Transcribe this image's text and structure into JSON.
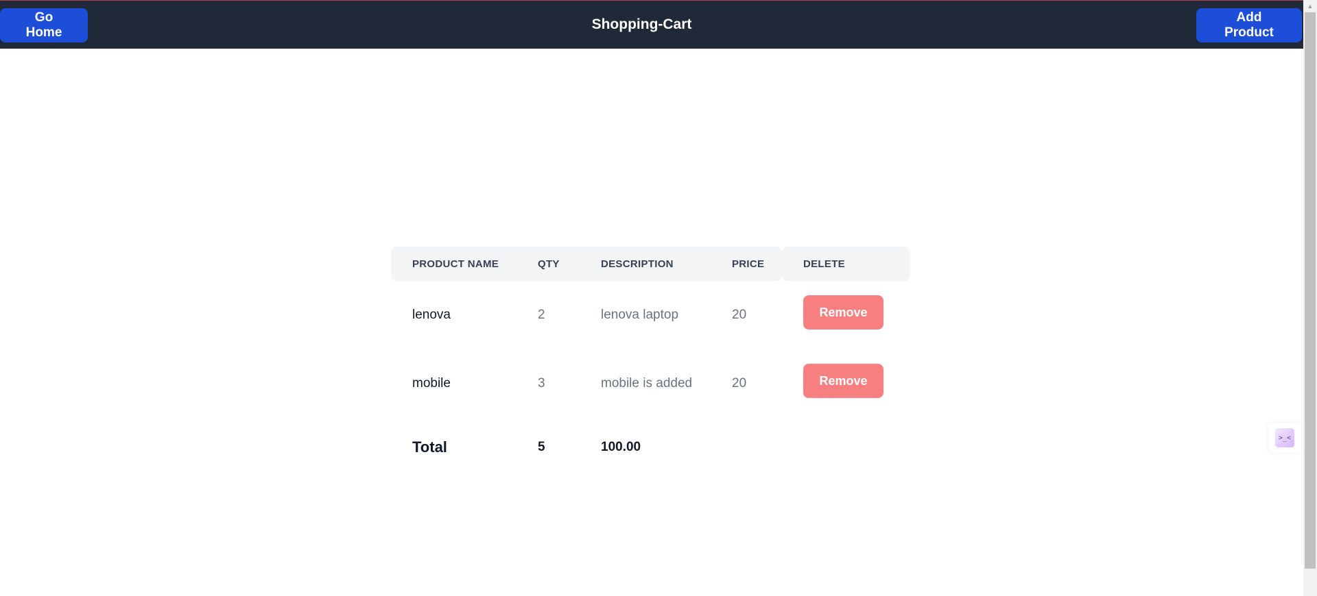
{
  "header": {
    "title": "Shopping-Cart",
    "home_label": "Go Home",
    "add_label": "Add Product"
  },
  "table": {
    "headers": [
      "PRODUCT NAME",
      "QTY",
      "DESCRIPTION",
      "PRICE",
      "DELETE"
    ],
    "rows": [
      {
        "name": "lenova",
        "qty": "2",
        "description": "lenova laptop",
        "price": "20",
        "action": "Remove"
      },
      {
        "name": "mobile",
        "qty": "3",
        "description": "mobile is added",
        "price": "20",
        "action": "Remove"
      }
    ],
    "total": {
      "label": "Total",
      "qty": "5",
      "amount": "100.00"
    }
  },
  "widget": {
    "glyph": ">_<"
  },
  "colors": {
    "navbar": "#1f2937",
    "primary_button": "#1d4ed8",
    "remove_button": "#f87f7f",
    "header_bg": "#f3f4f6"
  }
}
